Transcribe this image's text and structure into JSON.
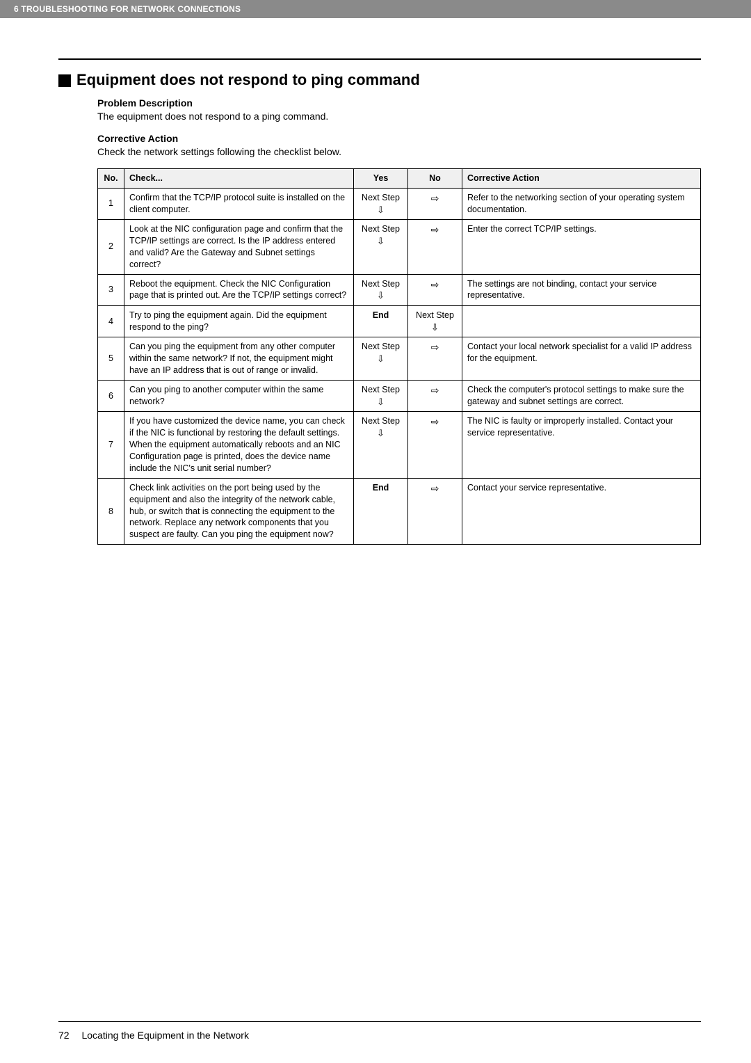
{
  "header": {
    "chapter": "6 TROUBLESHOOTING FOR NETWORK CONNECTIONS"
  },
  "section": {
    "title": "Equipment does not respond to ping command",
    "problem_heading": "Problem Description",
    "problem_text": "The equipment does not respond to a ping command.",
    "action_heading": "Corrective Action",
    "action_text": "Check the network settings following the checklist below."
  },
  "table": {
    "headers": {
      "no": "No.",
      "check": "Check...",
      "yes": "Yes",
      "no_col": "No",
      "corrective": "Corrective Action"
    },
    "rows": [
      {
        "no": "1",
        "check": "Confirm that the TCP/IP protocol suite is installed on the client computer.",
        "yes": "Next Step",
        "yes_arrow": "⇩",
        "no_cell": "⇨",
        "corrective": "Refer to the networking section of your operating system documentation."
      },
      {
        "no": "2",
        "check": "Look at the NIC configuration page and confirm that the TCP/IP settings are correct. Is the IP address entered and valid? Are the Gateway and Subnet settings correct?",
        "yes": "Next Step",
        "yes_arrow": "⇩",
        "no_cell": "⇨",
        "corrective": "Enter the correct TCP/IP settings."
      },
      {
        "no": "3",
        "check": "Reboot the equipment. Check the NIC Configuration page that is printed out. Are the TCP/IP settings correct?",
        "yes": "Next Step",
        "yes_arrow": "⇩",
        "no_cell": "⇨",
        "corrective": "The settings are not binding, contact your service representative."
      },
      {
        "no": "4",
        "check": "Try to ping the equipment again. Did the equipment respond to the ping?",
        "yes": "End",
        "yes_bold": true,
        "no_cell": "Next Step",
        "no_arrow": "⇩",
        "corrective": ""
      },
      {
        "no": "5",
        "check": "Can you ping the equipment from any other computer within the same network? If not, the equipment might have an IP address that is out of range or invalid.",
        "yes": "Next Step",
        "yes_arrow": "⇩",
        "no_cell": "⇨",
        "corrective": "Contact your local network specialist for a valid IP address for the equipment."
      },
      {
        "no": "6",
        "check": "Can you ping to another computer within the same network?",
        "yes": "Next Step",
        "yes_arrow": "⇩",
        "no_cell": "⇨",
        "corrective": "Check the computer's protocol settings to make sure the gateway and subnet settings are correct."
      },
      {
        "no": "7",
        "check": "If you have customized the device name, you can check if the NIC is functional by restoring the default settings. When the equipment automatically reboots and an NIC Configuration page is printed, does the device name include the NIC's unit serial number?",
        "yes": "Next Step",
        "yes_arrow": "⇩",
        "no_cell": "⇨",
        "corrective": "The NIC is faulty or improperly installed. Contact your service representative."
      },
      {
        "no": "8",
        "check": "Check link activities on the port being used by the equipment and also the integrity of the network cable, hub, or switch that is connecting the equipment to the network. Replace any network components that you suspect are faulty. Can you ping the equipment now?",
        "yes": "End",
        "yes_bold": true,
        "no_cell": "⇨",
        "corrective": "Contact your service representative."
      }
    ]
  },
  "footer": {
    "page": "72",
    "title": "Locating the Equipment in the Network"
  }
}
